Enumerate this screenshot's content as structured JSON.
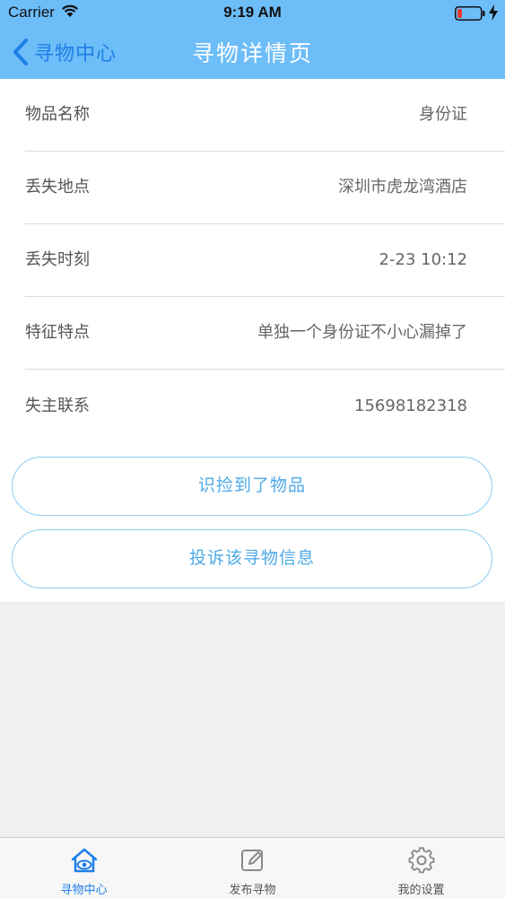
{
  "status_bar": {
    "carrier": "Carrier",
    "time": "9:19 AM"
  },
  "nav": {
    "back_label": "寻物中心",
    "title": "寻物详情页"
  },
  "details": [
    {
      "label": "物品名称",
      "value": "身份证"
    },
    {
      "label": "丢失地点",
      "value": "深圳市虎龙湾酒店"
    },
    {
      "label": "丢失时刻",
      "value": "2-23 10:12"
    },
    {
      "label": "特征特点",
      "value": "单独一个身份证不小心漏掉了"
    },
    {
      "label": "失主联系",
      "value": "15698182318"
    }
  ],
  "actions": {
    "found_label": "识捡到了物品",
    "report_label": "投诉该寻物信息"
  },
  "tabs": [
    {
      "label": "寻物中心",
      "icon": "home-eye-icon",
      "active": true
    },
    {
      "label": "发布寻物",
      "icon": "edit-icon",
      "active": false
    },
    {
      "label": "我的设置",
      "icon": "gear-icon",
      "active": false
    }
  ],
  "colors": {
    "header": "#6dbdf9",
    "accent": "#1e7fe6",
    "button_text": "#4ea9e8",
    "battery_low": "#e53935"
  }
}
